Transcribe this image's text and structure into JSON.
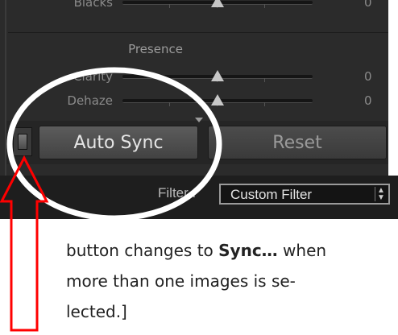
{
  "develop_panel": {
    "sliders": [
      {
        "label": "Blacks",
        "value": "0",
        "thumb_fraction": 0.5
      },
      {
        "label": "Clarity",
        "value": "0",
        "thumb_fraction": 0.5
      },
      {
        "label": "Dehaze",
        "value": "0",
        "thumb_fraction": 0.5
      }
    ],
    "section_title": "Presence",
    "buttons": {
      "auto_sync": "Auto Sync",
      "reset": "Reset"
    },
    "filter": {
      "label": "Filter :",
      "selected": "Custom Filter"
    }
  },
  "annotation": {
    "caption_lines": {
      "line1_pre": "button changes to ",
      "line1_bold": "Sync…",
      "line1_post": " when",
      "line2": "more than one images is se-",
      "line3": "lected.]"
    },
    "colors": {
      "circle": "#ffffff",
      "arrow": "#ff0000"
    },
    "icons": [
      "up-arrow-icon",
      "highlight-circle"
    ]
  },
  "colors": {
    "panel_background": "#2b2b2b",
    "filter_bar_background": "#1e1e1e",
    "button_text": "#e6e6e6",
    "disabled_text": "#9a9a9a"
  }
}
